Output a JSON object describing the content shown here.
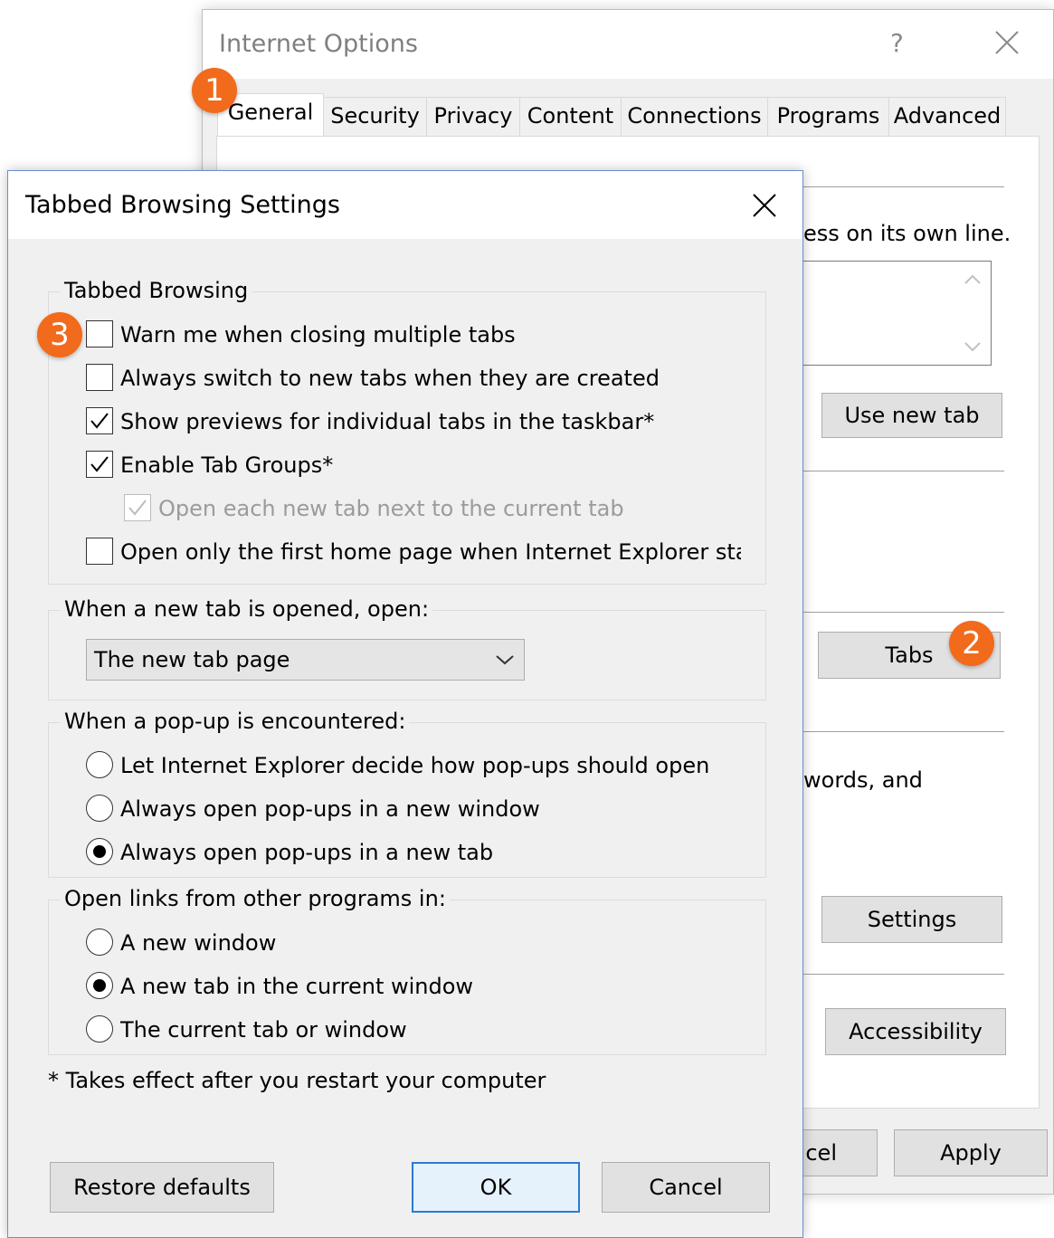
{
  "internet_options": {
    "title": "Internet Options",
    "help_glyph": "?",
    "tabs": [
      "General",
      "Security",
      "Privacy",
      "Content",
      "Connections",
      "Programs",
      "Advanced"
    ],
    "active_tab": "General",
    "snippets": {
      "home_page_hint": "ess on its own line.",
      "browsing_history_hint": "words, and"
    },
    "buttons": {
      "use_new_tab": "Use new tab",
      "tabs": "Tabs",
      "settings": "Settings",
      "accessibility": "Accessibility",
      "cancel_partial": "cel",
      "apply": "Apply"
    }
  },
  "tabbed_browsing_settings": {
    "title": "Tabbed Browsing Settings",
    "tabbed_browsing": {
      "heading": "Tabbed Browsing",
      "options": [
        {
          "label": "Warn me when closing multiple tabs",
          "checked": false,
          "enabled": true
        },
        {
          "label": "Always switch to new tabs when they are created",
          "checked": false,
          "enabled": true
        },
        {
          "label": "Show previews for individual tabs in the taskbar*",
          "checked": true,
          "enabled": true
        },
        {
          "label": "Enable Tab Groups*",
          "checked": true,
          "enabled": true
        },
        {
          "label": "Open each new tab next to the current tab",
          "checked": true,
          "enabled": false
        },
        {
          "label": "Open only the first home page when Internet Explorer starts",
          "checked": false,
          "enabled": true
        }
      ]
    },
    "new_tab": {
      "heading": "When a new tab is opened, open:",
      "selected": "The new tab page"
    },
    "popup": {
      "heading": "When a pop-up is encountered:",
      "options": [
        {
          "label": "Let Internet Explorer decide how pop-ups should open",
          "selected": false
        },
        {
          "label": "Always open pop-ups in a new window",
          "selected": false
        },
        {
          "label": "Always open pop-ups in a new tab",
          "selected": true
        }
      ]
    },
    "links": {
      "heading": "Open links from other programs in:",
      "options": [
        {
          "label": "A new window",
          "selected": false
        },
        {
          "label": "A new tab in the current window",
          "selected": true
        },
        {
          "label": "The current tab or window",
          "selected": false
        }
      ]
    },
    "footnote": "* Takes effect after you restart your computer",
    "buttons": {
      "restore": "Restore defaults",
      "ok": "OK",
      "cancel": "Cancel"
    }
  },
  "markers": [
    "1",
    "2",
    "3"
  ],
  "colors": {
    "marker": "#f26a1b",
    "default_button_border": "#2a7ad6",
    "dialog_background": "#f0f0f0"
  }
}
